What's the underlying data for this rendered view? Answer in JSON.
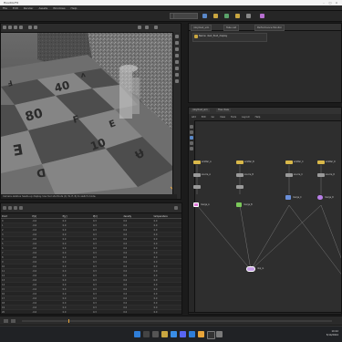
{
  "window": {
    "title": "Houdini FX"
  },
  "menubar": {
    "items": [
      "File",
      "Edit",
      "Render",
      "Assets",
      "Windows",
      "Help"
    ]
  },
  "shelf": {
    "field1": "Build",
    "field2": "Main"
  },
  "viewer": {
    "floor_glyphs": [
      "40",
      "80",
      "F",
      "E",
      "W",
      "O",
      "S",
      "I",
      "A",
      "U",
      "Ǝ",
      "10",
      "Ʉ",
      "ᗡ",
      "Ⅎ",
      "ᴧ"
    ],
    "status_text": "Camera-relative heads-up display. Use tool shortcuts (Q, W, E, R) to switch mode."
  },
  "param_panel": {
    "tabs": [
      "/obj/dust_sim",
      "Take List",
      "Performance Monitor"
    ],
    "row_label": "Name: dust_fluid_display"
  },
  "node_editor": {
    "tabs": [
      "/obj/dust_sim",
      "Tree View"
    ],
    "menu": [
      "Add",
      "Edit",
      "Go",
      "View",
      "Tools",
      "Layout",
      "Help"
    ],
    "nodes_top": [
      "emitter_A",
      "emitter_B",
      "emitter_C",
      "emitter_D"
    ],
    "nodes_mid": [
      "source_A",
      "source_B",
      "source_C",
      "source_D"
    ],
    "nodes_low": [
      "merge_A",
      "merge_B",
      "merge_C",
      "merge_D"
    ],
    "output_node": "dop_io"
  },
  "spreadsheet": {
    "headers": [
      "Point",
      "P[x]",
      "P[y]",
      "P[z]",
      "density",
      "temperature"
    ],
    "rows": [
      [
        "0",
        "-0.6",
        "0.0",
        "0.3",
        "0.0",
        "0.0"
      ],
      [
        "1",
        "-0.6",
        "0.0",
        "0.3",
        "0.0",
        "0.0"
      ],
      [
        "2",
        "-0.6",
        "0.0",
        "0.3",
        "0.0",
        "0.0"
      ],
      [
        "3",
        "-0.6",
        "0.0",
        "0.3",
        "0.0",
        "0.0"
      ],
      [
        "4",
        "-0.6",
        "0.0",
        "0.3",
        "0.0",
        "0.0"
      ],
      [
        "5",
        "-0.6",
        "0.0",
        "0.3",
        "0.0",
        "0.0"
      ],
      [
        "6",
        "-0.6",
        "0.0",
        "0.3",
        "0.0",
        "0.0"
      ],
      [
        "7",
        "-0.6",
        "0.0",
        "0.3",
        "0.0",
        "0.0"
      ],
      [
        "8",
        "-0.6",
        "0.0",
        "0.3",
        "0.0",
        "0.0"
      ],
      [
        "9",
        "-0.6",
        "0.0",
        "0.3",
        "0.0",
        "0.0"
      ],
      [
        "10",
        "-0.6",
        "0.0",
        "0.3",
        "0.0",
        "0.0"
      ],
      [
        "11",
        "-0.6",
        "0.0",
        "0.3",
        "0.0",
        "0.0"
      ],
      [
        "12",
        "-0.6",
        "0.0",
        "0.3",
        "0.0",
        "0.0"
      ],
      [
        "13",
        "-0.6",
        "0.0",
        "0.3",
        "0.0",
        "0.0"
      ],
      [
        "14",
        "-0.6",
        "0.0",
        "0.3",
        "0.0",
        "0.0"
      ],
      [
        "15",
        "-0.6",
        "0.0",
        "0.3",
        "0.0",
        "0.0"
      ],
      [
        "16",
        "-0.6",
        "0.0",
        "0.3",
        "0.0",
        "0.0"
      ],
      [
        "17",
        "-0.6",
        "0.0",
        "0.3",
        "0.0",
        "0.0"
      ],
      [
        "18",
        "-0.6",
        "0.0",
        "0.3",
        "0.0",
        "0.0"
      ],
      [
        "19",
        "-0.6",
        "0.0",
        "0.3",
        "0.0",
        "0.0"
      ],
      [
        "20",
        "-0.6",
        "0.0",
        "0.3",
        "0.0",
        "0.0"
      ],
      [
        "21",
        "-0.6",
        "0.0",
        "0.3",
        "0.0",
        "0.0"
      ],
      [
        "22",
        "-0.6",
        "0.0",
        "0.3",
        "0.0",
        "0.0"
      ],
      [
        "23",
        "-0.6",
        "0.0",
        "0.3",
        "0.0",
        "0.0"
      ]
    ]
  },
  "taskbar": {
    "time": "10:42",
    "date": "5/14/2024",
    "icons": [
      "start-icon",
      "search-icon",
      "widgets-icon",
      "task-view-icon",
      "explorer-icon",
      "browser-icon",
      "chat-icon",
      "mail-icon",
      "store-icon",
      "media-icon",
      "houdini-icon",
      "terminal-icon",
      "settings-icon"
    ]
  },
  "colors": {
    "node_yellow": "#d9b84a",
    "node_grey": "#9a9a9a",
    "node_pink": "#e07ad9",
    "node_purple": "#b87fe8",
    "wire": "#8a8a8a",
    "accent_orange": "#e8a53a"
  }
}
